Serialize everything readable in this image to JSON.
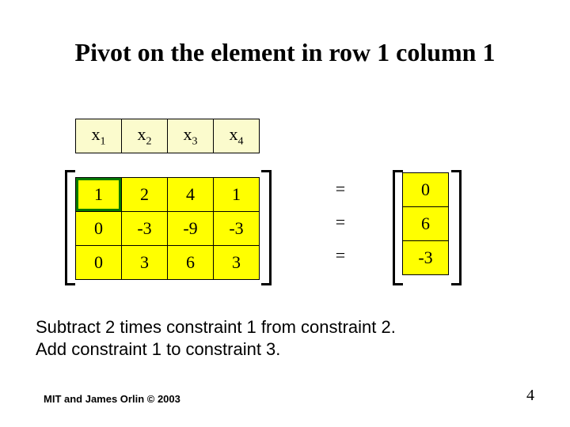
{
  "title": "Pivot on the element in row 1 column 1",
  "vars": [
    "x",
    "x",
    "x",
    "x"
  ],
  "subs": [
    "1",
    "2",
    "3",
    "4"
  ],
  "matrix": [
    [
      "1",
      "2",
      "4",
      "1"
    ],
    [
      "0",
      "-3",
      "-9",
      "-3"
    ],
    [
      "0",
      "3",
      "6",
      "3"
    ]
  ],
  "eq": [
    "=",
    "=",
    "="
  ],
  "rhs": [
    "0",
    "6",
    "-3"
  ],
  "body_line1": "Subtract 2 times constraint 1 from constraint 2.",
  "body_line2": "Add constraint 1 to constraint 3.",
  "footer": "MIT and James Orlin © 2003",
  "pagenum": "4"
}
